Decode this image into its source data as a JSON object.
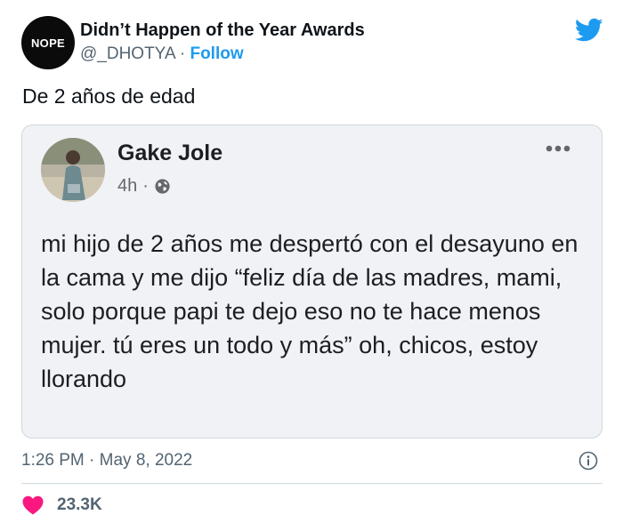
{
  "tweet": {
    "author": {
      "avatar_text": "NOPE",
      "name": "Didn’t Happen of the Year Awards",
      "handle": "@_DHOTYA",
      "separator": "·",
      "follow_label": "Follow"
    },
    "text": "De 2 años de edad",
    "timestamp": "1:26 PM · May 8, 2022",
    "like_count": "23.3K"
  },
  "embedded_post": {
    "name": "Gake Jole",
    "time": "4h",
    "separator": "·",
    "text": "mi hijo de 2 años me despertó con el desayuno en la cama y me dijo “feliz día de las madres, mami, solo porque papi te dejo eso no te hace menos mujer. tú eres un todo y más” oh, chicos, estoy llorando"
  },
  "colors": {
    "twitter_blue": "#1d9bf0",
    "like_pink": "#f91880",
    "muted_text": "#536471",
    "card_background": "#f0f2f5"
  },
  "icons": [
    "twitter-bird-icon",
    "globe-icon",
    "more-options-icon",
    "info-icon",
    "heart-icon"
  ]
}
